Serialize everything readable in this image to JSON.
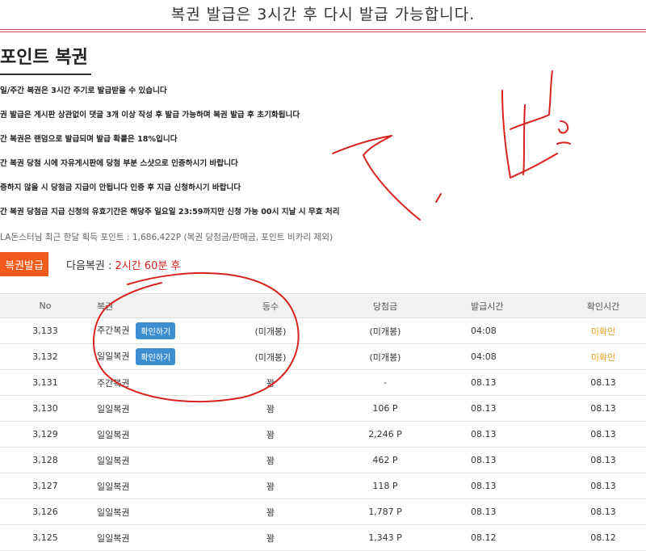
{
  "notice": "복권 발급은 3시간 후 다시 발급 가능합니다.",
  "title": "포인트 복권",
  "rules": [
    "일/주간 복권은 3시간 주기로 발급받을 수 있습니다",
    "권 발급은 게시판 상관없이 댓글 3개 이상 작성 후 발급 가능하며 복권 발급 후 초기화됩니다",
    "간 복권은 랜덤으로 발급되며 발급 확률은 18%입니다",
    "간 복권 당첨 시에 자유게시판에 당첨 부분 스샷으로 인증하시기 바랍니다",
    "증하지 않을 시 당첨금 지급이 안됩니다 인증 후 지급 신청하시기 바랍니다",
    "간 복권 당첨금 지급 신청의 유효기간은 해당주 일요일 23:59까지만 신청 가능 00시 지날 시 무효 처리"
  ],
  "stats": "LA돈스터님 최근 한달 획득 포인트 : 1,686,422P (복권 당첨금/판매금, 포인트 비카리 제외)",
  "issue_button": "복권발급",
  "next_lotto": {
    "label": "다음복권 : ",
    "timer": "2시간 60분 후"
  },
  "table": {
    "headers": [
      "No",
      "복권",
      "등수",
      "당첨금",
      "발급시간",
      "확인시간"
    ],
    "rows": [
      {
        "no": "3,133",
        "type": "주간복권",
        "button": "확인하기",
        "rank": "(미개봉)",
        "prize": "(미개봉)",
        "issued": "04:08",
        "checked": "미확인",
        "pending": true
      },
      {
        "no": "3,132",
        "type": "일일복권",
        "button": "확인하기",
        "rank": "(미개봉)",
        "prize": "(미개봉)",
        "issued": "04:08",
        "checked": "미확인",
        "pending": true
      },
      {
        "no": "3,131",
        "type": "주간복권",
        "rank": "꽝",
        "prize": "-",
        "issued": "08.13",
        "checked": "08.13"
      },
      {
        "no": "3,130",
        "type": "일일복권",
        "rank": "꽝",
        "prize": "106 P",
        "issued": "08.13",
        "checked": "08.13"
      },
      {
        "no": "3,129",
        "type": "일일복권",
        "rank": "꽝",
        "prize": "2,246 P",
        "issued": "08.13",
        "checked": "08.13"
      },
      {
        "no": "3,128",
        "type": "일일복권",
        "rank": "꽝",
        "prize": "462 P",
        "issued": "08.13",
        "checked": "08.13"
      },
      {
        "no": "3,127",
        "type": "일일복권",
        "rank": "꽝",
        "prize": "118 P",
        "issued": "08.13",
        "checked": "08.13"
      },
      {
        "no": "3,126",
        "type": "일일복권",
        "rank": "꽝",
        "prize": "1,787 P",
        "issued": "08.13",
        "checked": "08.13"
      },
      {
        "no": "3,125",
        "type": "일일복권",
        "rank": "꽝",
        "prize": "1,343 P",
        "issued": "08.12",
        "checked": "08.12"
      }
    ]
  },
  "colors": {
    "accent": "#f05a1a",
    "confirm": "#3d8fd1",
    "unchecked": "#f0a020",
    "timer": "#d9231e"
  }
}
